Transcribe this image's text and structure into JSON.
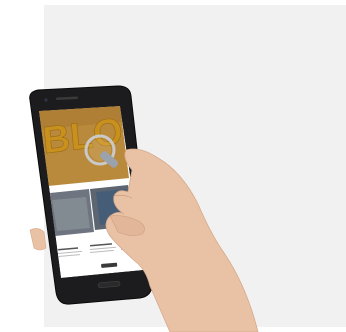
{
  "hero": {
    "word": "BLOG",
    "word_color": "#c8901c",
    "bg_color": "#b98a3c"
  },
  "page": {
    "background": "#f1f1f1",
    "screen_background": "#ffffff"
  },
  "cards": {
    "button_color": "#3a3a3a"
  },
  "icons": {
    "magnifier": "magnifying-glass-icon",
    "hand": "hand-icon"
  }
}
